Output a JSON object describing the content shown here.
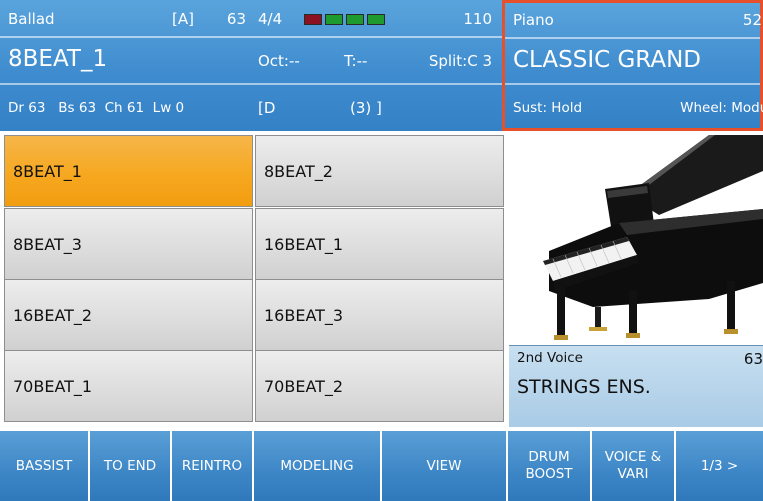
{
  "style_header": {
    "category": "Ballad",
    "bank": "[A]",
    "value": "63",
    "name": "8BEAT_1",
    "levels": "Dr 63   Bs 63  Ch 61  Lw 0"
  },
  "mid_header": {
    "time_signature": "4/4",
    "tempo": "110",
    "octave": "Oct:--",
    "transpose": "T:--",
    "split": "Split:C 3",
    "chord": "[D",
    "chord_num": "(3) ]",
    "meter_colors": [
      "#8b1020",
      "#1e9a2e",
      "#1e9a2e",
      "#1e9a2e"
    ]
  },
  "voice_header": {
    "category": "Piano",
    "value": "52",
    "name": "CLASSIC GRAND",
    "sustain": "Sust: Hold",
    "wheel": "Wheel: Modul"
  },
  "styles": [
    "8BEAT_1",
    "8BEAT_2",
    "8BEAT_3",
    "16BEAT_1",
    "16BEAT_2",
    "16BEAT_3",
    "70BEAT_1",
    "70BEAT_2"
  ],
  "second_voice": {
    "label": "2nd Voice",
    "value": "63",
    "name": "STRINGS ENS."
  },
  "buttons": [
    "BASSIST",
    "TO END",
    "REINTRO",
    "MODELING",
    "VIEW",
    "DRUM\nBOOST",
    "VOICE &\nVARI",
    "1/3 >"
  ],
  "colors": {
    "accent": "#3f8ccf",
    "selected": "#f6a820",
    "highlight_border": "#e6502a"
  }
}
